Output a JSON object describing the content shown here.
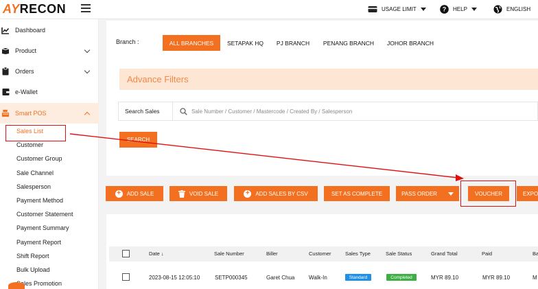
{
  "header": {
    "logo_ay": "AY",
    "logo_recon": "RECON",
    "usage_limit": "USAGE LIMIT",
    "help": "HELP",
    "language": "ENGLISH"
  },
  "sidebar": {
    "items": [
      {
        "label": "Dashboard"
      },
      {
        "label": "Product"
      },
      {
        "label": "Orders"
      },
      {
        "label": "e-Wallet"
      },
      {
        "label": "Smart POS"
      }
    ],
    "submenu": [
      "Sales List",
      "Customer",
      "Customer Group",
      "Sale Channel",
      "Salesperson",
      "Payment Method",
      "Customer Statement",
      "Payment Summary",
      "Payment Report",
      "Shift Report",
      "Bulk Upload",
      "Sales Promotion"
    ]
  },
  "filters": {
    "branch_label": "Branch :",
    "branches": [
      "ALL BRANCHES",
      "SETAPAK HQ",
      "PJ BRANCH",
      "PENANG BRANCH",
      "JOHOR BRANCH"
    ],
    "advance_filters": "Advance Filters",
    "search_label": "Search Sales",
    "search_placeholder": "Sale Number / Customer / Mastercode / Created By / Salesperson",
    "search_button": "SEARCH"
  },
  "actions": {
    "add_sale": "ADD SALE",
    "void_sale": "VOID SALE",
    "add_sales_csv": "ADD SALES BY CSV",
    "set_complete": "SET AS COMPLETE",
    "pass_order": "PASS ORDER",
    "voucher": "VOUCHER",
    "export": "EXPO"
  },
  "table": {
    "headers": [
      "Date ↓",
      "Sale Number",
      "Biller",
      "Customer",
      "Sales Type",
      "Sale Status",
      "Grand Total",
      "Paid",
      "Ba"
    ],
    "rows": [
      {
        "date": "2023-08-15 12:05:10",
        "sale_number": "SETP000345",
        "biller": "Garet Chua",
        "customer": "Walk-In",
        "sales_type": "Standard",
        "sale_status": "Completed",
        "grand_total": "MYR 89.10",
        "paid": "MYR 89.10",
        "balance": "M"
      }
    ]
  },
  "colors": {
    "accent": "#f37021",
    "annotation": "#e01010",
    "badge_standard": "#1e90e8",
    "badge_completed": "#3cb043"
  }
}
